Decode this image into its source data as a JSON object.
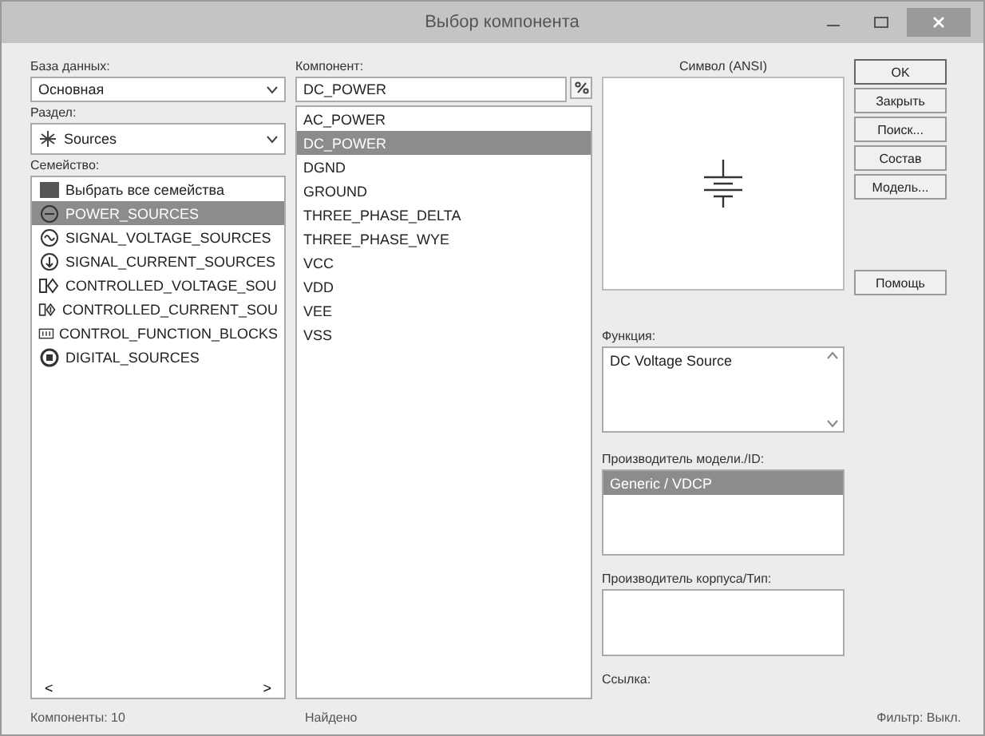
{
  "window": {
    "title": "Выбор компонента"
  },
  "database": {
    "label": "База данных:",
    "value": "Основная"
  },
  "section": {
    "label": "Раздел:",
    "value": "Sources"
  },
  "families": {
    "label": "Семейство:",
    "items": [
      {
        "text": "Выбрать все семейства",
        "selected": false
      },
      {
        "text": "POWER_SOURCES",
        "selected": true
      },
      {
        "text": "SIGNAL_VOLTAGE_SOURCES",
        "selected": false
      },
      {
        "text": "SIGNAL_CURRENT_SOURCES",
        "selected": false
      },
      {
        "text": "CONTROLLED_VOLTAGE_SOU",
        "selected": false
      },
      {
        "text": "CONTROLLED_CURRENT_SOU",
        "selected": false
      },
      {
        "text": "CONTROL_FUNCTION_BLOCKS",
        "selected": false
      },
      {
        "text": "DIGITAL_SOURCES",
        "selected": false
      }
    ],
    "scroll_left": "<",
    "scroll_right": ">"
  },
  "component": {
    "label": "Компонент:",
    "value": "DC_POWER",
    "items": [
      {
        "text": "AC_POWER",
        "selected": false
      },
      {
        "text": "DC_POWER",
        "selected": true
      },
      {
        "text": "DGND",
        "selected": false
      },
      {
        "text": "GROUND",
        "selected": false
      },
      {
        "text": "THREE_PHASE_DELTA",
        "selected": false
      },
      {
        "text": "THREE_PHASE_WYE",
        "selected": false
      },
      {
        "text": "VCC",
        "selected": false
      },
      {
        "text": "VDD",
        "selected": false
      },
      {
        "text": "VEE",
        "selected": false
      },
      {
        "text": "VSS",
        "selected": false
      }
    ]
  },
  "symbol": {
    "label": "Символ (ANSI)"
  },
  "function": {
    "label": "Функция:",
    "value": "DC Voltage Source"
  },
  "model_maker": {
    "label": "Производитель модели./ID:",
    "items": [
      {
        "text": "Generic / VDCP",
        "selected": true
      }
    ]
  },
  "package_maker": {
    "label": "Производитель корпуса/Тип:"
  },
  "link": {
    "label": "Ссылка:"
  },
  "buttons": [
    "OK",
    "Закрыть",
    "Поиск...",
    "Состав",
    "Модель..."
  ],
  "help_button": "Помощь",
  "status_bar": {
    "components": "Компоненты: 10",
    "found": "Найдено",
    "filter": "Фильтр: Выкл."
  }
}
